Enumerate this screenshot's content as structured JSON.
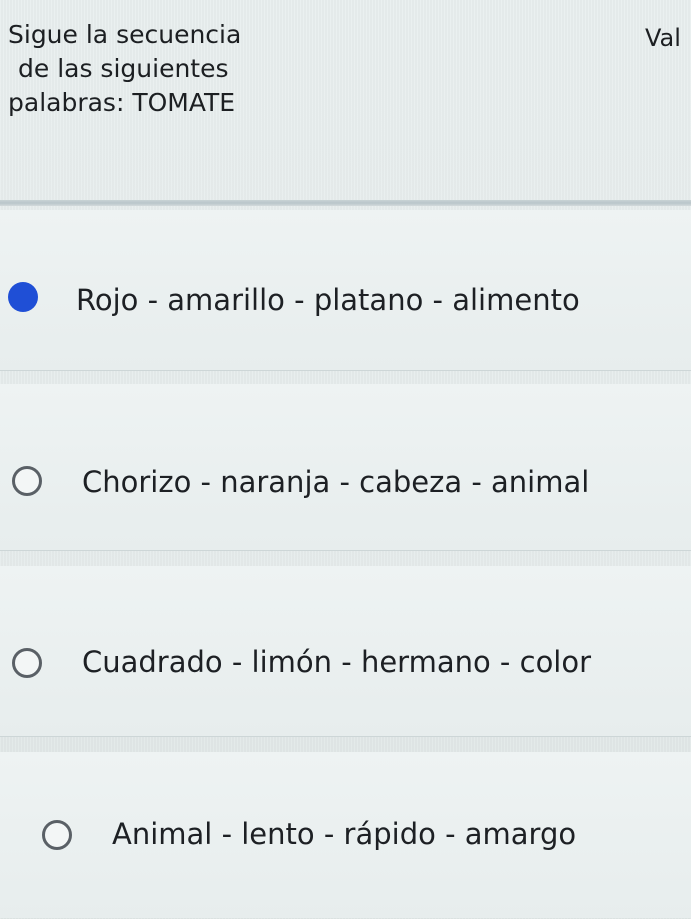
{
  "question": {
    "line1": "Sigue la secuencia",
    "line2": "de las siguientes",
    "line3": "palabras: TOMATE"
  },
  "header_right": "Val",
  "options": [
    {
      "label": "Rojo - amarillo - platano - alimento",
      "selected": true
    },
    {
      "label": "Chorizo - naranja - cabeza - animal",
      "selected": false
    },
    {
      "label": "Cuadrado - limón - hermano - color",
      "selected": false
    },
    {
      "label": "Animal - lento - rápido - amargo",
      "selected": false
    }
  ],
  "colors": {
    "selected_radio": "#1f4fd6",
    "background": "#e8eeee"
  }
}
